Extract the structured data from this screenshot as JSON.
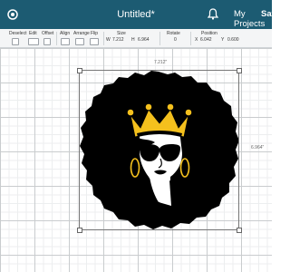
{
  "header": {
    "title": "Untitled*",
    "my_projects": "My Projects",
    "save": "Save"
  },
  "toolbar": {
    "deselect": "Deselect",
    "edit": "Edit",
    "offset": "Offset",
    "align": "Align",
    "arrange": "Arrange",
    "flip": "Flip",
    "size": "Size",
    "rotate": "Rotate",
    "position": "Position",
    "width_label": "W",
    "width_value": "7.212",
    "height_label": "H",
    "height_value": "6.964",
    "rotate_value": "0",
    "x_label": "X",
    "x_value": "6.042",
    "y_label": "Y",
    "y_value": "0.600"
  },
  "canvas": {
    "width_dim": "7.212\"",
    "height_dim": "6.964\""
  },
  "colors": {
    "titlebar": "#1c5b72",
    "crown": "#f4c01d",
    "artwork": "#000000"
  },
  "icons": [
    "cricut-logo-icon",
    "bell-icon"
  ]
}
